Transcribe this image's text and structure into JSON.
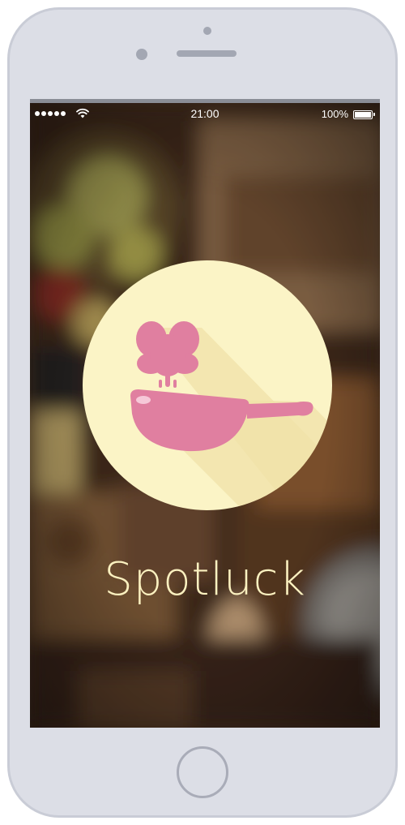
{
  "status_bar": {
    "time": "21:00",
    "battery_percent": "100%",
    "signal_bars": 5,
    "battery_level": 1.0
  },
  "splash": {
    "app_name": "Spotluck",
    "logo_icon": "wok-with-leaf-icon"
  },
  "colors": {
    "logo_circle": "#fbf4c6",
    "logo_mark": "#e07fa0",
    "app_name_text": "#fbf1c0",
    "device_body": "#dcdee6"
  },
  "icons": {
    "wifi": "wifi-icon",
    "battery": "battery-icon",
    "signal": "signal-dots-icon"
  }
}
